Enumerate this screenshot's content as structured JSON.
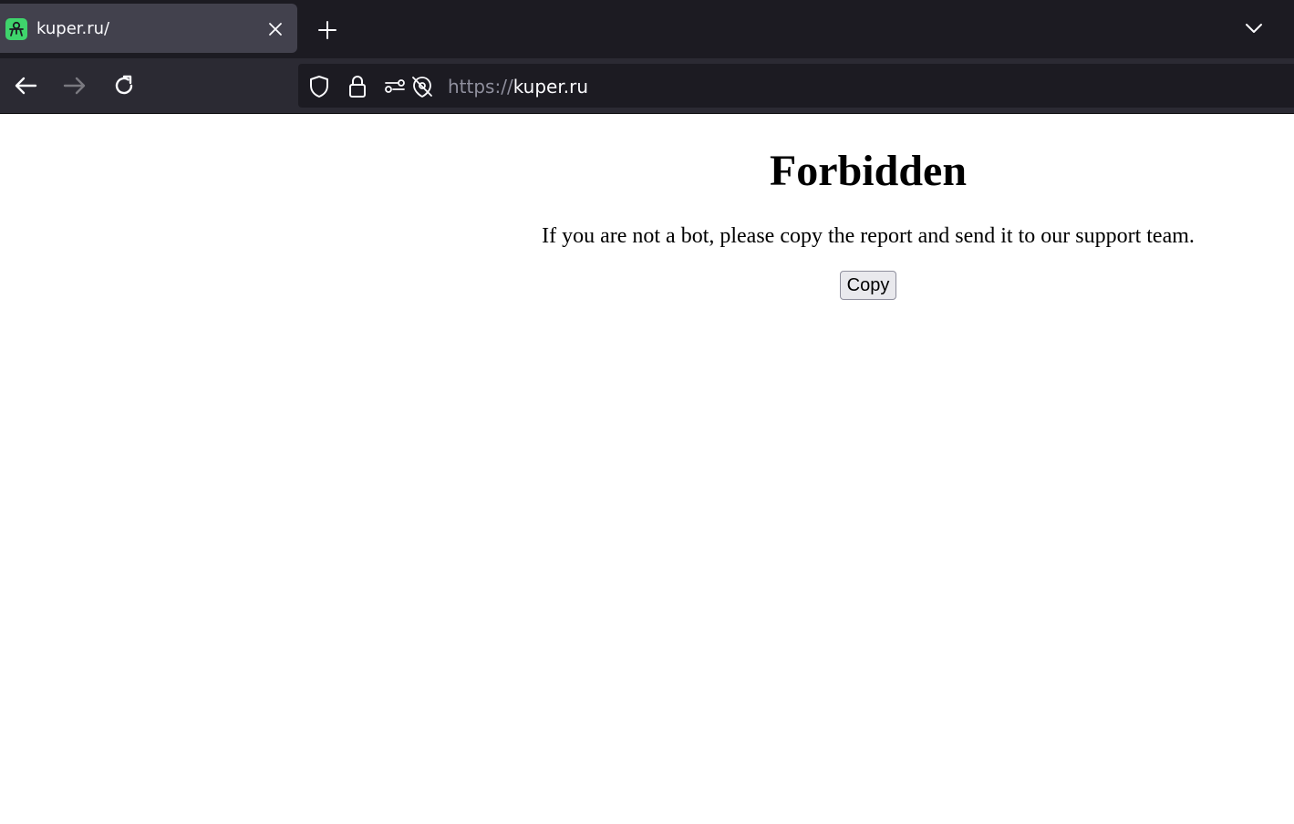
{
  "browser": {
    "tab": {
      "title": "kuper.ru/",
      "favicon": "kuper-logo-icon",
      "favicon_color": "#3fd46c"
    },
    "urlbar": {
      "scheme": "https://",
      "host": "kuper.ru"
    },
    "icons": {
      "close": "close-icon",
      "new_tab": "plus-icon",
      "tab_list": "chevron-down-icon",
      "back": "back-arrow-icon",
      "forward": "forward-arrow-icon",
      "reload": "reload-icon",
      "shield": "shield-icon",
      "lock": "lock-icon",
      "permissions": "permissions-icon",
      "tracking": "tracking-blocked-icon"
    },
    "colors": {
      "tabstrip": "#1c1b22",
      "active_tab": "#42414d",
      "navbar": "#2b2a33",
      "text": "#fbfbfe"
    }
  },
  "page": {
    "heading": "Forbidden",
    "message": "If you are not a bot, please copy the report and send it to our support team.",
    "copy_button": "Copy"
  }
}
